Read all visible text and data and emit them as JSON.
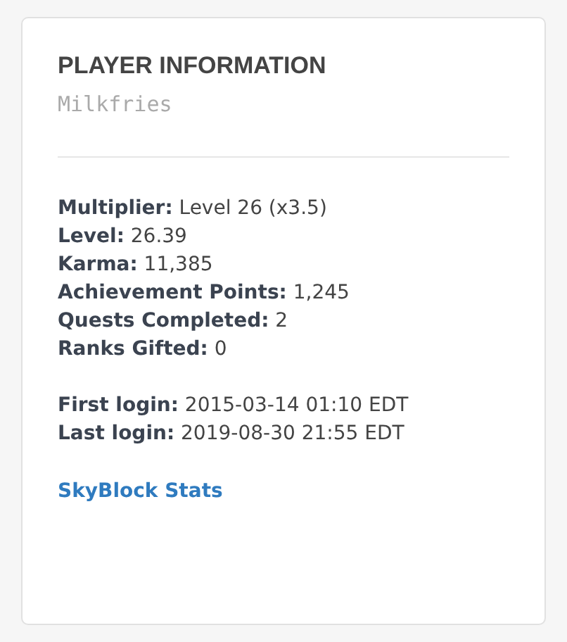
{
  "card": {
    "title": "PLAYER INFORMATION",
    "username": "Milkfries",
    "stats": [
      "**Multiplier:** Level 26 (x3.5)",
      "**Level:** 26.39",
      "**Karma:** 11,385",
      "**Achievement Points:** 1,245",
      "**Quests Completed:** 2",
      "**Ranks Gifted:** 0"
    ],
    "logins": [
      "**First login:** 2015-03-14 01:10 EDT",
      "**Last login:** 2019-08-30 21:55 EDT"
    ],
    "link": "SkyBlock Stats"
  }
}
